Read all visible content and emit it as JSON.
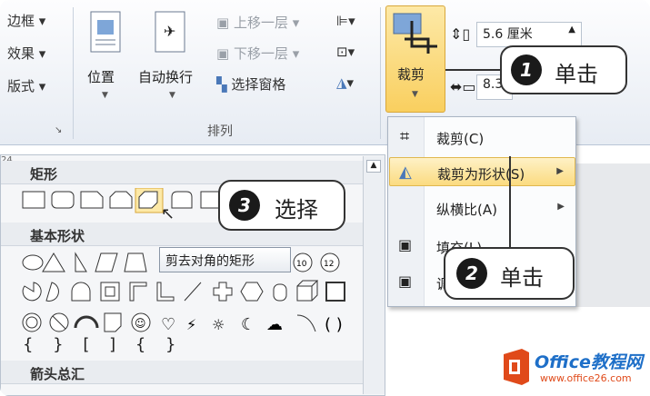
{
  "ribbon": {
    "left_items": [
      "边框",
      "效果",
      "版式"
    ],
    "position_label": "位置",
    "wrap_label": "自动换行",
    "bring_forward": "上移一层",
    "send_backward": "下移一层",
    "selection_pane": "选择窗格",
    "group_arrange": "排列",
    "height_value": "5.6 厘米",
    "width_value": "8.3",
    "crop_label": "裁剪"
  },
  "crop_menu": {
    "items": [
      {
        "label": "裁剪(C)",
        "icon": "crop-icon"
      },
      {
        "label": "裁剪为形状(S)",
        "icon": "shape-icon",
        "submenu": true
      },
      {
        "label": "纵横比(A)",
        "submenu": true
      },
      {
        "label": "填充(L)",
        "icon": "fill-icon"
      },
      {
        "label": "调",
        "icon": "fit-icon"
      }
    ]
  },
  "gallery": {
    "sections": [
      "矩形",
      "基本形状",
      "箭头总汇"
    ],
    "tooltip": "剪去对角的矩形",
    "ruler_mark": "24"
  },
  "callouts": [
    {
      "num": "1",
      "text": "单击"
    },
    {
      "num": "2",
      "text": "单击"
    },
    {
      "num": "3",
      "text": "选择"
    }
  ],
  "watermark": {
    "brand": "Office教程网",
    "url": "www.office26.com"
  },
  "colors": {
    "highlight": "#fbdb80",
    "accent": "#f9cf5f",
    "logo_red": "#e04a1a"
  }
}
